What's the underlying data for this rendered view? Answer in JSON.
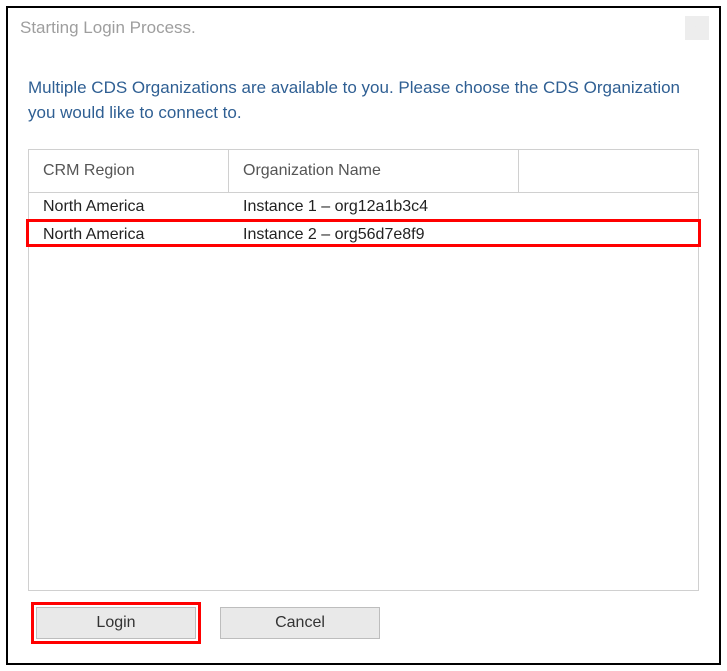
{
  "window": {
    "title": "Starting Login Process."
  },
  "instructions": "Multiple CDS Organizations are available to you. Please choose the CDS Organization you would like to connect to.",
  "grid": {
    "headers": {
      "region": "CRM Region",
      "org": "Organization Name",
      "extra": ""
    },
    "rows": [
      {
        "region": "North America",
        "org": "Instance 1 – org12a1b3c4",
        "highlighted": false
      },
      {
        "region": "North America",
        "org": "Instance 2 – org56d7e8f9",
        "highlighted": true
      }
    ]
  },
  "buttons": {
    "login": "Login",
    "cancel": "Cancel"
  },
  "highlights": {
    "login_button": true
  }
}
